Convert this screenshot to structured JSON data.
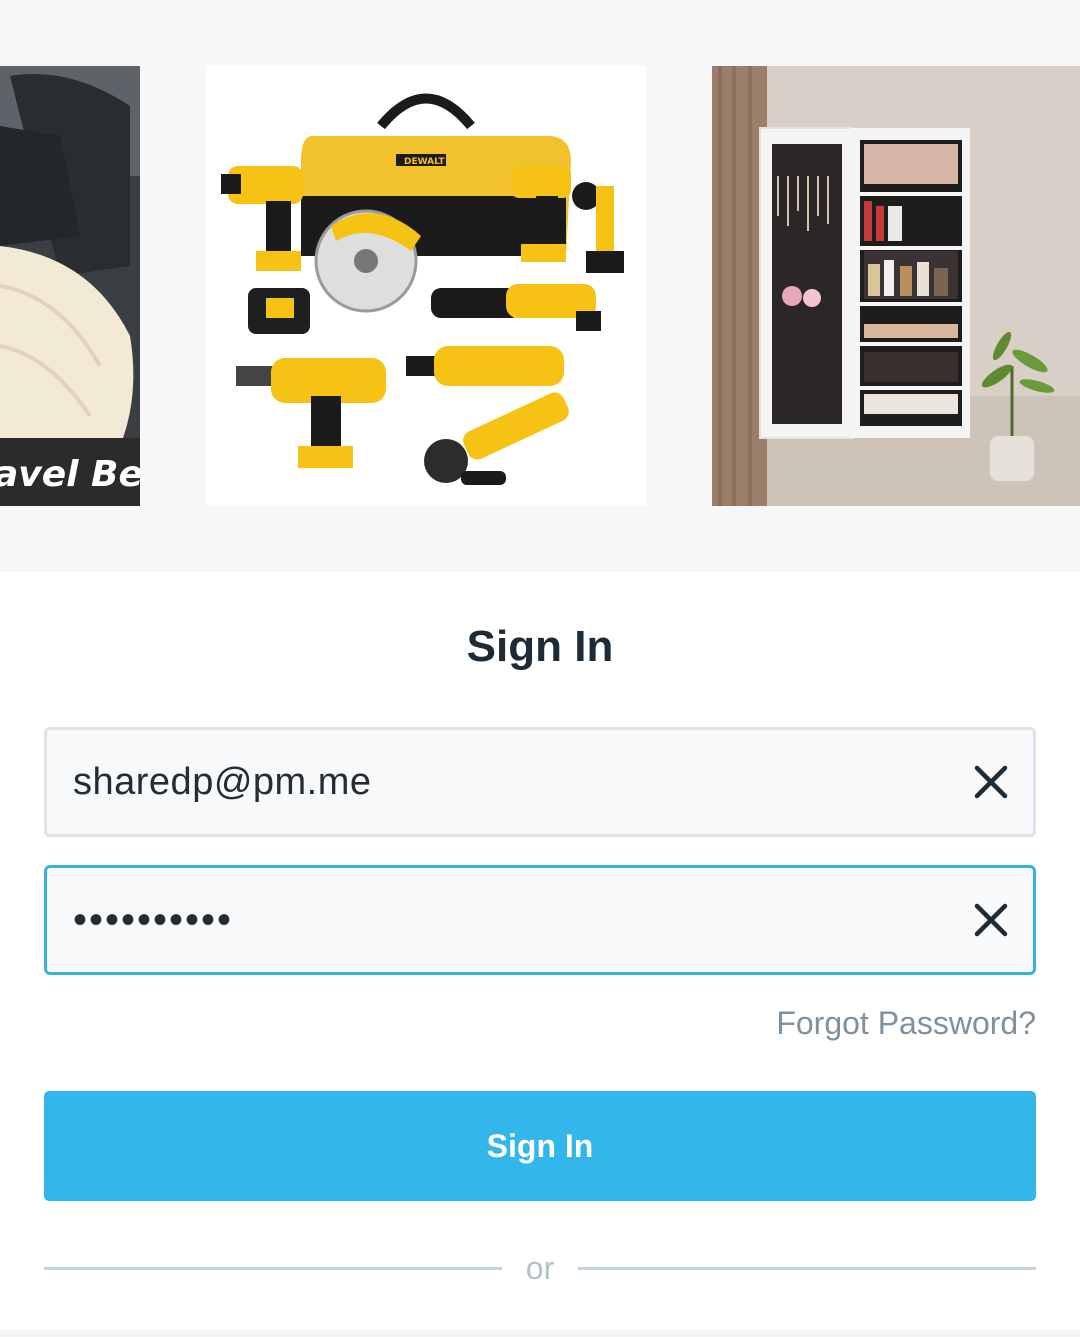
{
  "carousel": {
    "items": [
      {
        "name": "car-travel-bed",
        "caption": "avel Bed"
      },
      {
        "name": "dewalt-tool-kit",
        "brand": "DEWALT"
      },
      {
        "name": "jewelry-mirror-cabinet"
      }
    ]
  },
  "form": {
    "title": "Sign In",
    "email": {
      "value": "sharedp@pm.me"
    },
    "password": {
      "value": "••••••••••"
    },
    "forgot_label": "Forgot Password?",
    "submit_label": "Sign In",
    "divider_label": "or"
  },
  "colors": {
    "accent": "#33b7ea",
    "focus_border": "#35b3e6",
    "title": "#1d2b36",
    "muted": "#7f919f"
  },
  "icons": {
    "clear": "close-icon"
  }
}
